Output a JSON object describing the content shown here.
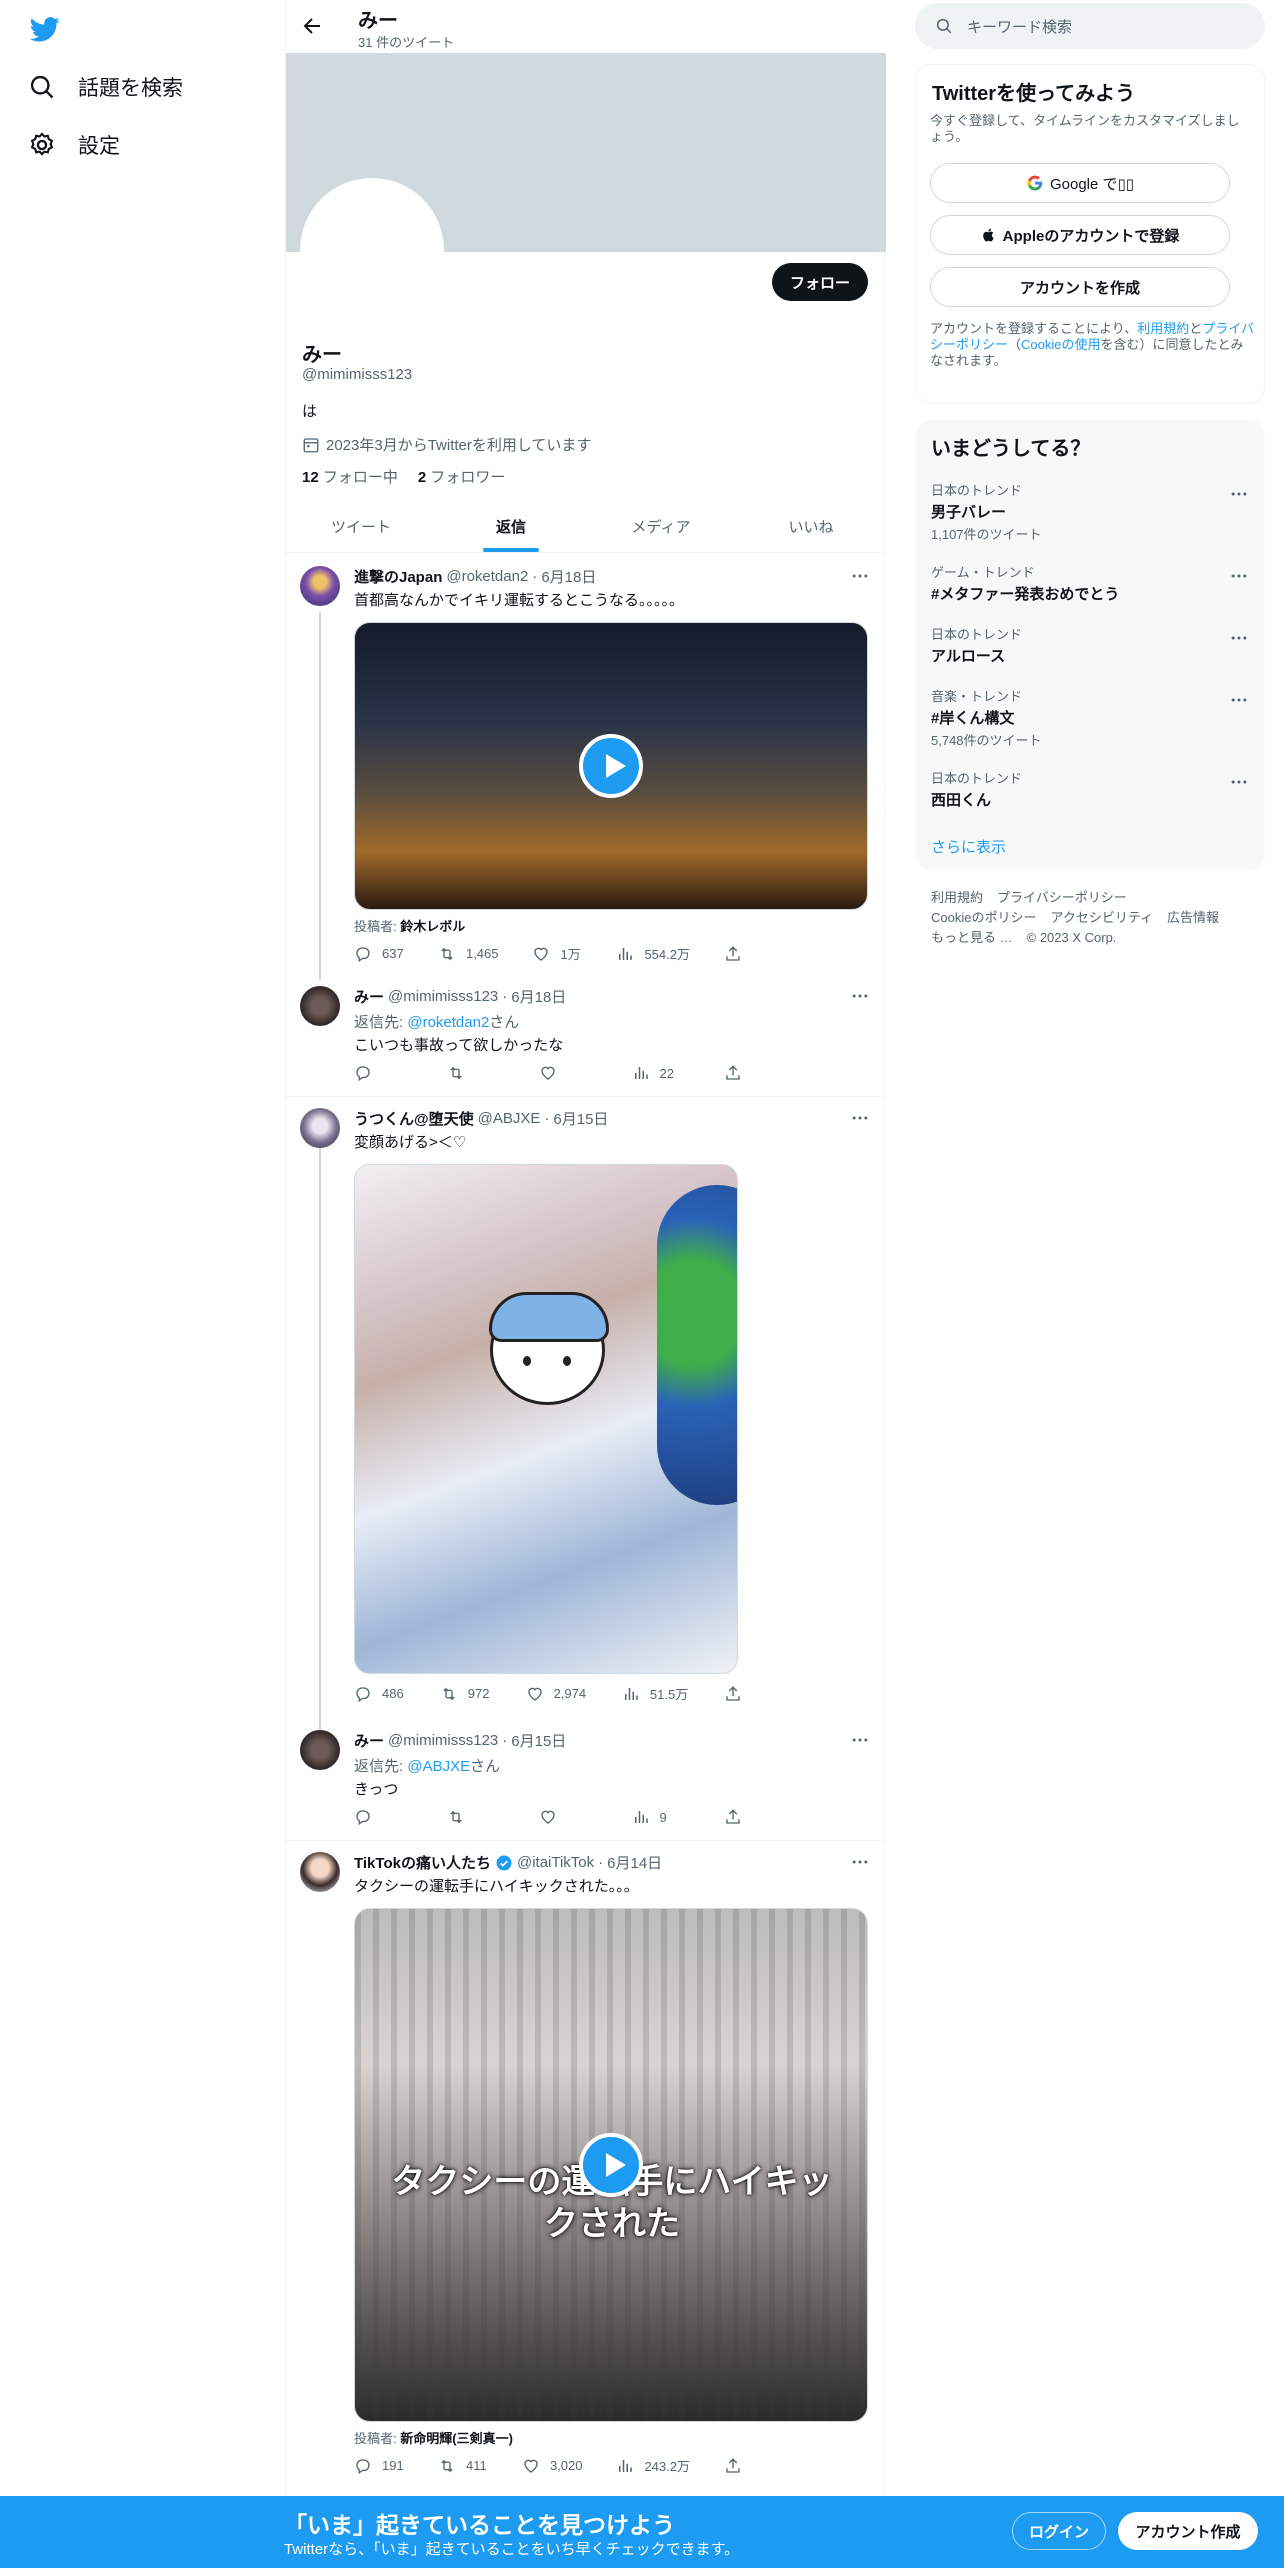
{
  "nav": {
    "logo_icon": "twitter-bird-icon",
    "items": [
      {
        "icon": "search-icon",
        "label": "話題を検索"
      },
      {
        "icon": "gear-icon",
        "label": "設定"
      }
    ]
  },
  "header": {
    "name": "みー",
    "tweet_count": "31 件のツイート"
  },
  "profile": {
    "follow_label": "フォロー",
    "name": "みー",
    "handle": "@mimimisss123",
    "bio": "は",
    "joined": "2023年3月からTwitterを利用しています",
    "following_count": "12",
    "following_label": "フォロー中",
    "followers_count": "2",
    "followers_label": "フォロワー"
  },
  "tabs": [
    {
      "label": "ツイート",
      "active": false
    },
    {
      "label": "返信",
      "active": true
    },
    {
      "label": "メディア",
      "active": false
    },
    {
      "label": "いいね",
      "active": false
    }
  ],
  "tweets": [
    {
      "name": "進撃のJapan",
      "handle": "@roketdan2",
      "date": "6月18日",
      "text": "首都高なんかでイキリ運転するとこうなる。。。。。",
      "poster_prefix": "投稿者: ",
      "poster": "鈴木レボル",
      "replies": "637",
      "retweets": "1,465",
      "likes": "1万",
      "views": "554.2万"
    },
    {
      "name": "みー",
      "handle": "@mimimisss123",
      "date": "6月18日",
      "reply_prefix": "返信先: ",
      "reply_to": "@roketdan2",
      "reply_suffix": "さん",
      "text": "こいつも事故って欲しかったな",
      "replies": "",
      "retweets": "",
      "likes": "",
      "views": "22"
    },
    {
      "name": "うつくん@堕天使",
      "handle": "@ABJXE",
      "date": "6月15日",
      "text": "変顔あげる>＜♡",
      "replies": "486",
      "retweets": "972",
      "likes": "2,974",
      "views": "51.5万"
    },
    {
      "name": "みー",
      "handle": "@mimimisss123",
      "date": "6月15日",
      "reply_prefix": "返信先: ",
      "reply_to": "@ABJXE",
      "reply_suffix": "さん",
      "text": "きっつ",
      "replies": "",
      "retweets": "",
      "likes": "",
      "views": "9"
    },
    {
      "name": "TikTokの痛い人たち",
      "handle": "@itaiTikTok",
      "date": "6月14日",
      "text": "タクシーの運転手にハイキックされた。。。",
      "video_caption": "タクシーの運転手にハイキックされた",
      "poster_prefix": "投稿者: ",
      "poster": "新命明輝(三剣真一)",
      "replies": "191",
      "retweets": "411",
      "likes": "3,020",
      "views": "243.2万"
    }
  ],
  "right": {
    "search_placeholder": "キーワード検索",
    "signup": {
      "title": "Twitterを使ってみよう",
      "subtitle": "今すぐ登録して、タイムラインをカスタマイズしましょう。",
      "google_label": "Google で▯▯",
      "apple_label": "Appleのアカウントで登録",
      "create_label": "アカウントを作成",
      "legal_prefix": "アカウントを登録することにより、",
      "terms": "利用規約",
      "and": "と",
      "privacy": "プライバシーポリシー",
      "cookie_open": "（",
      "cookie": "Cookieの使用",
      "legal_suffix": "を含む）に同意したとみなされます。"
    },
    "trends_title": "いまどうしてる？",
    "trends": [
      {
        "category": "日本のトレンド",
        "name": "男子バレー",
        "count": "1,107件のツイート"
      },
      {
        "category": "ゲーム・トレンド",
        "name": "#メタファー発表おめでとう",
        "count": ""
      },
      {
        "category": "日本のトレンド",
        "name": "アルロース",
        "count": ""
      },
      {
        "category": "音楽・トレンド",
        "name": "#岸くん構文",
        "count": "5,748件のツイート"
      },
      {
        "category": "日本のトレンド",
        "name": "西田くん",
        "count": ""
      }
    ],
    "show_more": "さらに表示",
    "footer": [
      "利用規約",
      "プライバシーポリシー",
      "Cookieのポリシー",
      "アクセシビリティ",
      "広告情報",
      "もっと見る …",
      "© 2023 X Corp."
    ]
  },
  "bottom_bar": {
    "title": "「いま」起きていることを見つけよう",
    "subtitle": "Twitterなら、「いま」起きていることをいち早くチェックできます。",
    "login": "ログイン",
    "signup": "アカウント作成"
  },
  "colors": {
    "accent": "#1d9bf0",
    "text": "#0f1419",
    "muted": "#536471",
    "banner": "#cfd9de"
  }
}
